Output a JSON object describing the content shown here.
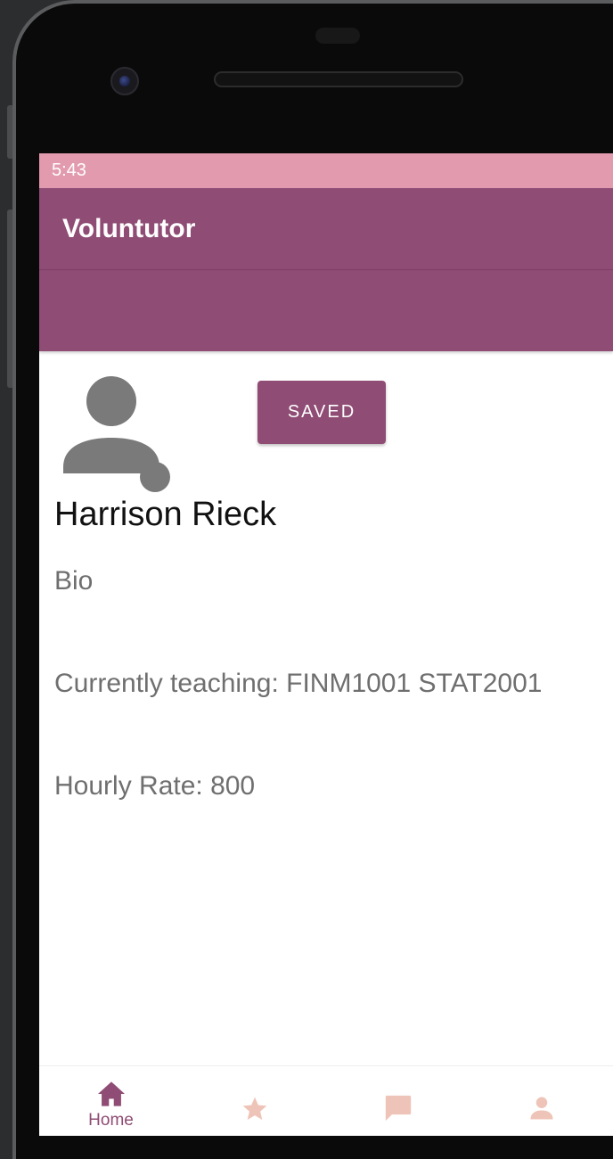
{
  "status_bar": {
    "time": "5:43"
  },
  "app_bar": {
    "title": "Voluntutor"
  },
  "profile": {
    "avatar_icon": "person-icon",
    "save_label": "SAVED",
    "name": "Harrison Rieck",
    "bio_label": "Bio",
    "teaching": "Currently teaching: FINM1001  STAT2001",
    "hourly_rate": "Hourly Rate: 800"
  },
  "bottom_nav": {
    "items": [
      {
        "icon": "home-icon",
        "label": "Home",
        "active": true
      },
      {
        "icon": "star-icon",
        "label": "",
        "active": false
      },
      {
        "icon": "chat-icon",
        "label": "",
        "active": false
      },
      {
        "icon": "person-icon",
        "label": "",
        "active": false
      }
    ]
  },
  "colors": {
    "primary": "#8f4c74",
    "status_bar": "#e29aae",
    "inactive_icon": "#efc4b8",
    "avatar_grey": "#7a7a7a"
  }
}
